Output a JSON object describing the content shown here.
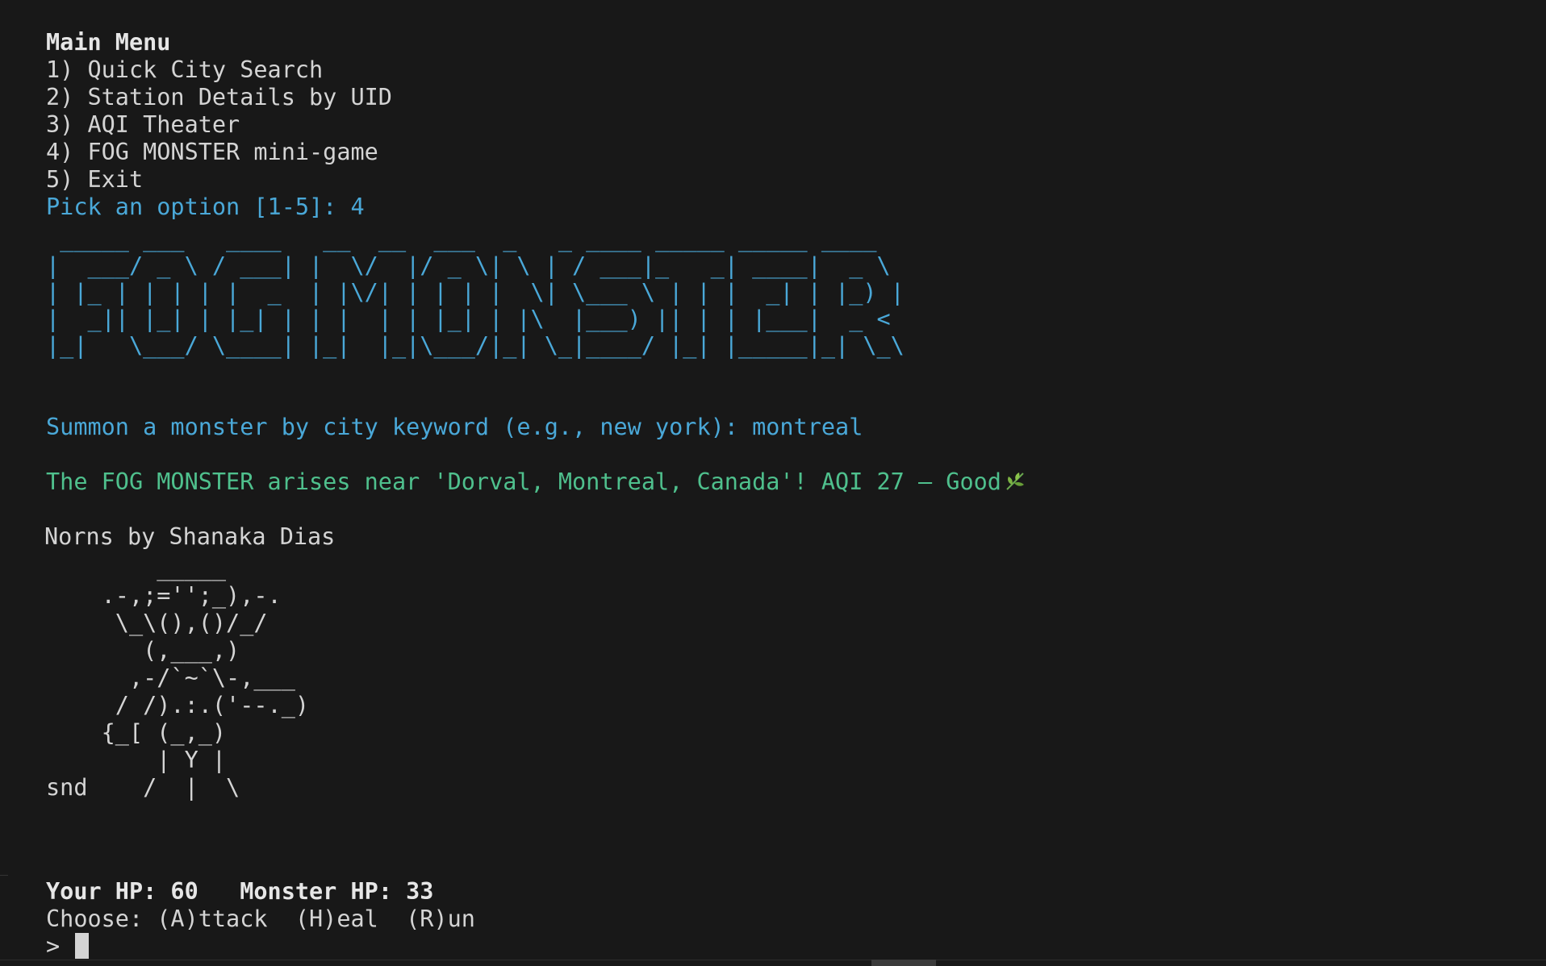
{
  "terminal": {
    "clipped_top_line": "- - - - - - - - - - - - - - - - - - - - - - - - - - -",
    "menu": {
      "title": "Main Menu",
      "items": [
        "1) Quick City Search",
        "2) Station Details by UID",
        "3) AQI Theater",
        "4) FOG MONSTER mini-game",
        "5) Exit"
      ],
      "prompt": "Pick an option [1-5]: 4"
    },
    "banner_ascii": " _____ ___   ____   __  __  ___  _   _ ____ _____ _____ ____\n|  ___/ _ \\ / ___| |  \\/  |/ _ \\| \\ | / ___|_   _| ____|  _ \\\n| |_ | | | | |  _  | |\\/| | | | |  \\| \\___ \\ | | |  _| | |_) |\n|  _|| |_| | |_| | | |  | | |_| | |\\  |___) || | | |___|  _ <\n|_|   \\___/ \\____| |_|  |_|\\___/|_| \\_|____/ |_| |_____|_| \\_\\",
    "summon_prompt": "Summon a monster by city keyword (e.g., new york): montreal",
    "arise_message": "The FOG MONSTER arises near 'Dorval, Montreal, Canada'! AQI 27 — Good",
    "arise_icon": "herb-leaf-icon",
    "art_title": "Norns by Shanaka Dias",
    "art_ascii": "        _____\n    .-,;='';_),-.\n     \\_\\(),()/_/\n       (,___,)\n      ,-/`~`\\-,___\n     / /).:.('--._)\n    {_[ (_,_)\n        | Y |\nsnd    /  |  \\",
    "status": {
      "your_hp_label": "Your HP: 60",
      "monster_hp_label": "Monster HP: 33"
    },
    "choose_line": "Choose: (A)ttack  (H)eal  (R)un",
    "input_prompt": "> ",
    "colors": {
      "background": "#181818",
      "foreground": "#d4d4d4",
      "blue": "#4aa8d8",
      "green": "#4fc08d"
    }
  }
}
